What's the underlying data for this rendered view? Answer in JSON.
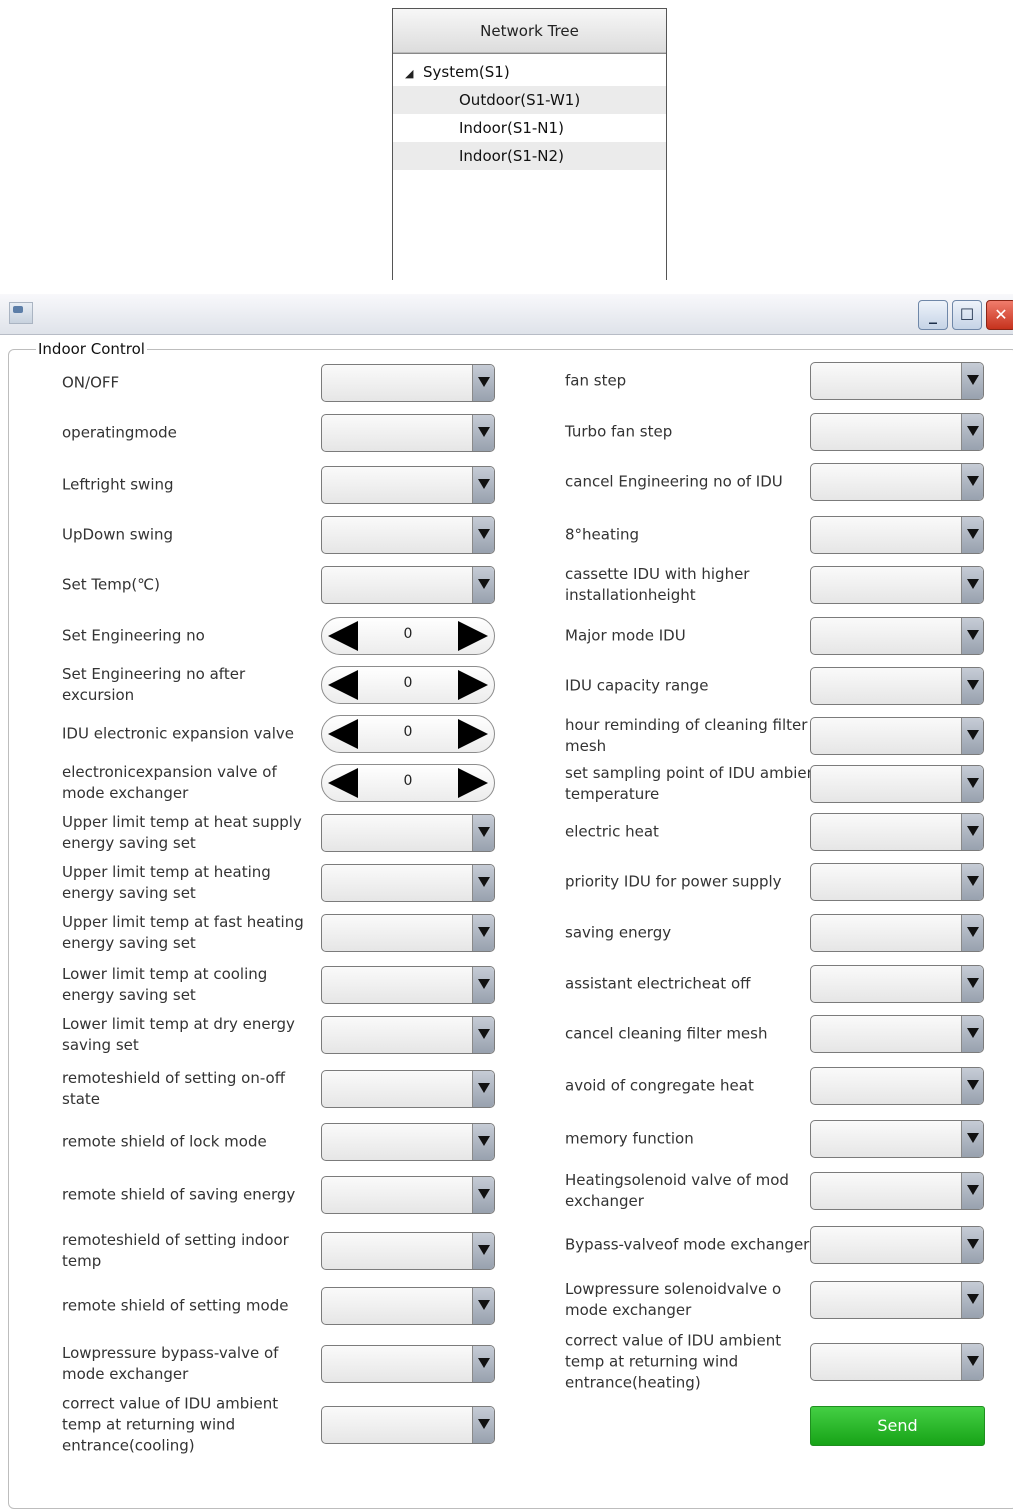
{
  "tree": {
    "header": "Network Tree",
    "root": "System(S1)",
    "children": [
      "Outdoor(S1-W1)",
      "Indoor(S1-N1)",
      "Indoor(S1-N2)"
    ]
  },
  "window": {
    "group_title": "Indoor Control",
    "send_label": "Send"
  },
  "left_controls": [
    {
      "label": "ON/OFF",
      "type": "select",
      "value": ""
    },
    {
      "label": "operatingmode",
      "type": "select",
      "value": ""
    },
    {
      "label": "Leftright swing",
      "type": "select",
      "value": ""
    },
    {
      "label": "UpDown swing",
      "type": "select",
      "value": ""
    },
    {
      "label": "Set Temp(℃)",
      "type": "select",
      "value": ""
    },
    {
      "label": "Set Engineering no",
      "type": "stepper",
      "value": "0"
    },
    {
      "label": "Set Engineering no after excursion",
      "type": "stepper",
      "value": "0"
    },
    {
      "label": "IDU electronic expansion valve",
      "type": "stepper",
      "value": "0"
    },
    {
      "label": "electronicexpansion valve of mode exchanger",
      "type": "stepper",
      "value": "0"
    },
    {
      "label": "Upper limit temp at heat supply energy saving set",
      "type": "select",
      "value": ""
    },
    {
      "label": "Upper limit temp at heating energy saving set",
      "type": "select",
      "value": ""
    },
    {
      "label": "Upper limit temp at fast heating energy saving set",
      "type": "select",
      "value": ""
    },
    {
      "label": "Lower limit temp at cooling energy saving set",
      "type": "select",
      "value": ""
    },
    {
      "label": "Lower limit temp at dry energy saving set",
      "type": "select",
      "value": ""
    },
    {
      "label": "remoteshield of setting on-off state",
      "type": "select",
      "value": ""
    },
    {
      "label": "remote shield of lock mode",
      "type": "select",
      "value": ""
    },
    {
      "label": "remote shield of saving energy",
      "type": "select",
      "value": ""
    },
    {
      "label": "remoteshield of setting indoor temp",
      "type": "select",
      "value": ""
    },
    {
      "label": "remote shield of setting mode",
      "type": "select",
      "value": ""
    },
    {
      "label": "Lowpressure bypass-valve of mode exchanger",
      "type": "select",
      "value": ""
    },
    {
      "label": "correct value of IDU ambient temp at returning wind entrance(cooling)",
      "type": "select",
      "value": ""
    }
  ],
  "right_controls": [
    {
      "label": "fan step",
      "type": "select",
      "value": ""
    },
    {
      "label": "Turbo fan step",
      "type": "select",
      "value": ""
    },
    {
      "label": "cancel Engineering no of IDU",
      "type": "select",
      "value": ""
    },
    {
      "label": "8°heating",
      "type": "select",
      "value": ""
    },
    {
      "label": "cassette IDU with higher installationheight",
      "type": "select",
      "value": ""
    },
    {
      "label": "Major mode IDU",
      "type": "select",
      "value": ""
    },
    {
      "label": "IDU capacity range",
      "type": "select",
      "value": ""
    },
    {
      "label": "hour reminding of cleaning filter mesh",
      "type": "select",
      "value": ""
    },
    {
      "label": "set sampling point of IDU ambient temperature",
      "type": "select",
      "value": ""
    },
    {
      "label": "electric heat",
      "type": "select",
      "value": ""
    },
    {
      "label": "priority IDU for power supply",
      "type": "select",
      "value": ""
    },
    {
      "label": "saving energy",
      "type": "select",
      "value": ""
    },
    {
      "label": "assistant electricheat off",
      "type": "select",
      "value": ""
    },
    {
      "label": "cancel cleaning filter mesh",
      "type": "select",
      "value": ""
    },
    {
      "label": "avoid of congregate heat",
      "type": "select",
      "value": ""
    },
    {
      "label": "memory function",
      "type": "select",
      "value": ""
    },
    {
      "label": "Heatingsolenoid valve of mod exchanger",
      "type": "select",
      "value": ""
    },
    {
      "label": "Bypass-valveof mode exchanger",
      "type": "select",
      "value": ""
    },
    {
      "label": "Lowpressure solenoidvalve o mode exchanger",
      "type": "select",
      "value": ""
    },
    {
      "label": "correct value of IDU ambient temp at returning wind entrance(heating)",
      "type": "select",
      "value": ""
    }
  ]
}
